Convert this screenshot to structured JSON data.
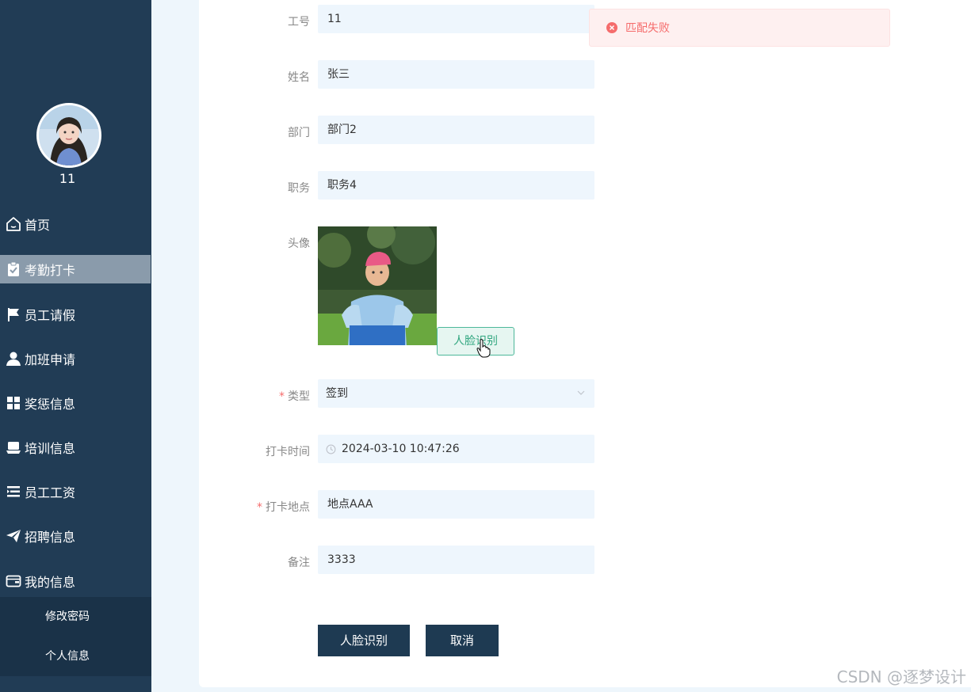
{
  "sidebar": {
    "user_name": "11",
    "items": [
      {
        "label": "首页",
        "icon": "home-icon"
      },
      {
        "label": "考勤打卡",
        "icon": "clipboard-check-icon"
      },
      {
        "label": "员工请假",
        "icon": "flag-icon"
      },
      {
        "label": "加班申请",
        "icon": "user-icon"
      },
      {
        "label": "奖惩信息",
        "icon": "grid-icon"
      },
      {
        "label": "培训信息",
        "icon": "laptop-icon"
      },
      {
        "label": "员工工资",
        "icon": "list-icon"
      },
      {
        "label": "招聘信息",
        "icon": "paper-plane-icon"
      },
      {
        "label": "我的信息",
        "icon": "wallet-icon"
      }
    ],
    "active_index": 1,
    "submenu": [
      "修改密码",
      "个人信息"
    ]
  },
  "form": {
    "fields": {
      "employee_no": {
        "label": "工号",
        "value": "11"
      },
      "name": {
        "label": "姓名",
        "value": "张三"
      },
      "department": {
        "label": "部门",
        "value": "部门2"
      },
      "position": {
        "label": "职务",
        "value": "职务4"
      },
      "avatar": {
        "label": "头像"
      },
      "type": {
        "label": "类型",
        "value": "签到",
        "required": true
      },
      "clock_time": {
        "label": "打卡时间",
        "value": "2024-03-10 10:47:26"
      },
      "location": {
        "label": "打卡地点",
        "value": "地点AAA",
        "required": true
      },
      "remark": {
        "label": "备注",
        "value": "3333"
      }
    },
    "face_button_small": "人脸识别",
    "submit_label": "人脸识别",
    "cancel_label": "取消"
  },
  "toast": {
    "message": "匹配失败",
    "color": "#f56c6c"
  },
  "watermark": "CSDN @逐梦设计",
  "colors": {
    "sidebar": "#213c55",
    "active": "#8a9bab",
    "primary_button": "#1e3a52",
    "input_bg": "#eef6fd"
  }
}
